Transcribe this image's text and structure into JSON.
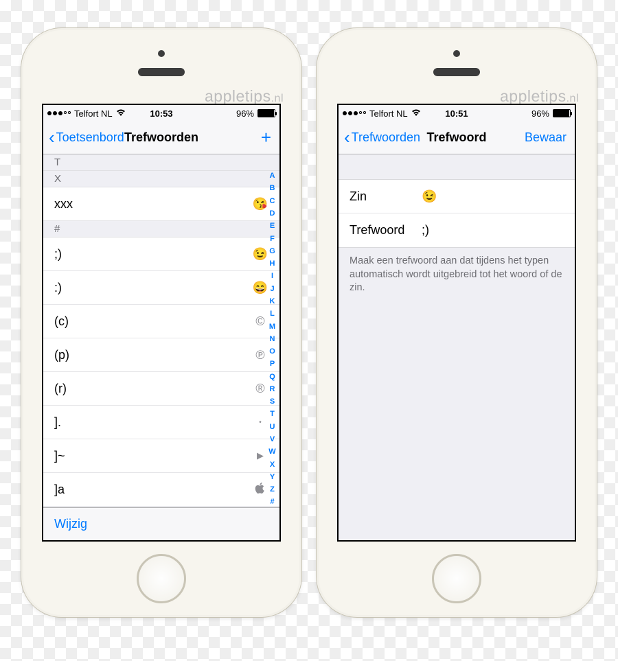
{
  "watermark": {
    "text": "appletips",
    "suffix": ".nl"
  },
  "phone_left": {
    "status": {
      "carrier": "Telfort NL",
      "time": "10:53",
      "battery": "96%"
    },
    "nav": {
      "back": "Toetsenbord",
      "title": "Trefwoorden",
      "add": "+"
    },
    "sections": {
      "t_header": "T",
      "x_header": "X",
      "x_rows": [
        {
          "key": "xxx",
          "val": "😘"
        }
      ],
      "hash_header": "#",
      "hash_rows": [
        {
          "key": ";)",
          "val": "😉"
        },
        {
          "key": ":)",
          "val": "😄"
        },
        {
          "key": "(c)",
          "val": "©"
        },
        {
          "key": "(p)",
          "val": "℗"
        },
        {
          "key": "(r)",
          "val": "®"
        },
        {
          "key": "].",
          "val": "•"
        },
        {
          "key": "]~",
          "val": "▶"
        },
        {
          "key": "]a",
          "val": ""
        }
      ]
    },
    "index": [
      "A",
      "B",
      "C",
      "D",
      "E",
      "F",
      "G",
      "H",
      "I",
      "J",
      "K",
      "L",
      "M",
      "N",
      "O",
      "P",
      "Q",
      "R",
      "S",
      "T",
      "U",
      "V",
      "W",
      "X",
      "Y",
      "Z",
      "#"
    ],
    "toolbar": {
      "edit": "Wijzig"
    }
  },
  "phone_right": {
    "status": {
      "carrier": "Telfort NL",
      "time": "10:51",
      "battery": "96%"
    },
    "nav": {
      "back": "Trefwoorden",
      "title": "Trefwoord",
      "save": "Bewaar"
    },
    "form": {
      "phrase_label": "Zin",
      "phrase_value": "😉",
      "shortcut_label": "Trefwoord",
      "shortcut_value": ";)"
    },
    "footer": "Maak een trefwoord aan dat tijdens het typen automatisch wordt uitgebreid tot het woord of de zin."
  }
}
